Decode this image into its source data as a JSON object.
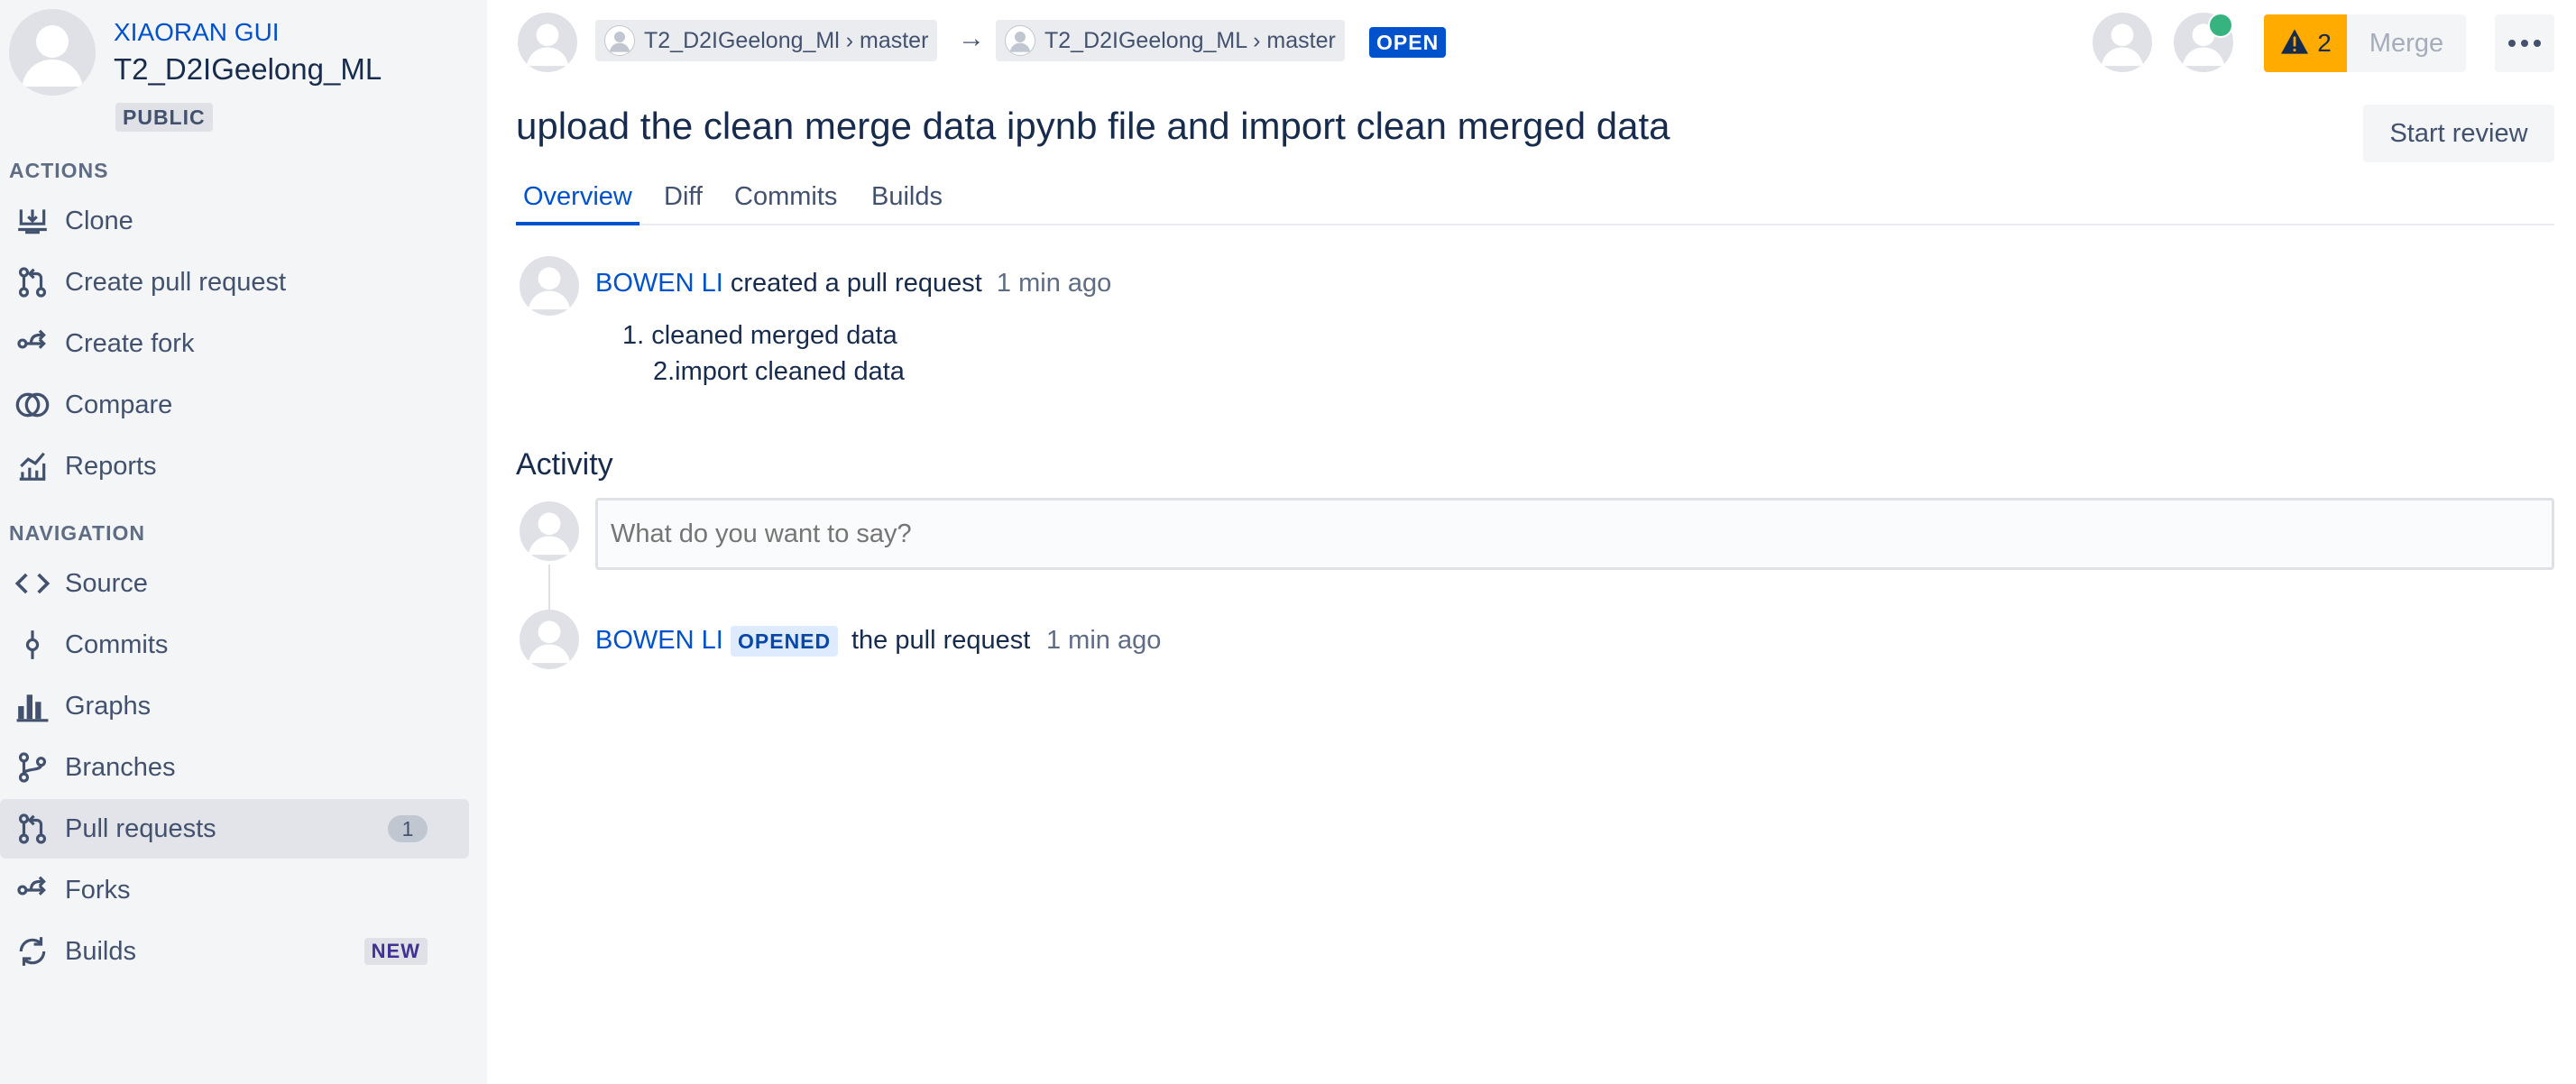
{
  "sidebar": {
    "owner": "XIAORAN GUI",
    "repo_name": "T2_D2IGeelong_ML",
    "visibility": "PUBLIC",
    "actions_heading": "ACTIONS",
    "actions": [
      {
        "label": "Clone",
        "icon": "clone-icon"
      },
      {
        "label": "Create pull request",
        "icon": "pull-request-icon"
      },
      {
        "label": "Create fork",
        "icon": "fork-icon"
      },
      {
        "label": "Compare",
        "icon": "compare-icon"
      },
      {
        "label": "Reports",
        "icon": "reports-icon"
      }
    ],
    "navigation_heading": "NAVIGATION",
    "navigation": [
      {
        "label": "Source",
        "icon": "code-icon"
      },
      {
        "label": "Commits",
        "icon": "commit-icon"
      },
      {
        "label": "Graphs",
        "icon": "graph-icon"
      },
      {
        "label": "Branches",
        "icon": "branch-icon"
      },
      {
        "label": "Pull requests",
        "icon": "pull-request-icon",
        "count": "1",
        "active": true
      },
      {
        "label": "Forks",
        "icon": "fork-icon"
      },
      {
        "label": "Builds",
        "icon": "builds-icon",
        "badge": "NEW"
      }
    ]
  },
  "header": {
    "source_branch": "T2_D2IGeelong_Ml › master",
    "target_branch": "T2_D2IGeelong_ML › master",
    "arrow": "→",
    "status": "OPEN",
    "warning_count": "2",
    "merge_label": "Merge",
    "more_label": "More actions",
    "accent_color": "#0052cc",
    "warning_color": "#ffab00"
  },
  "pr": {
    "title": "upload the clean merge data ipynb file and import clean merged data",
    "start_review_label": "Start review"
  },
  "tabs": [
    {
      "label": "Overview",
      "active": true
    },
    {
      "label": "Diff"
    },
    {
      "label": "Commits"
    },
    {
      "label": "Builds"
    }
  ],
  "overview": {
    "author": "BOWEN LI",
    "action": "created a pull request",
    "time": "1 min ago",
    "description_lines": [
      "1. cleaned merged data",
      "2.import cleaned data"
    ]
  },
  "activity": {
    "heading": "Activity",
    "comment_placeholder": "What do you want to say?",
    "events": [
      {
        "author": "BOWEN LI",
        "badge": "OPENED",
        "text": "the pull request",
        "time": "1 min ago"
      }
    ]
  }
}
